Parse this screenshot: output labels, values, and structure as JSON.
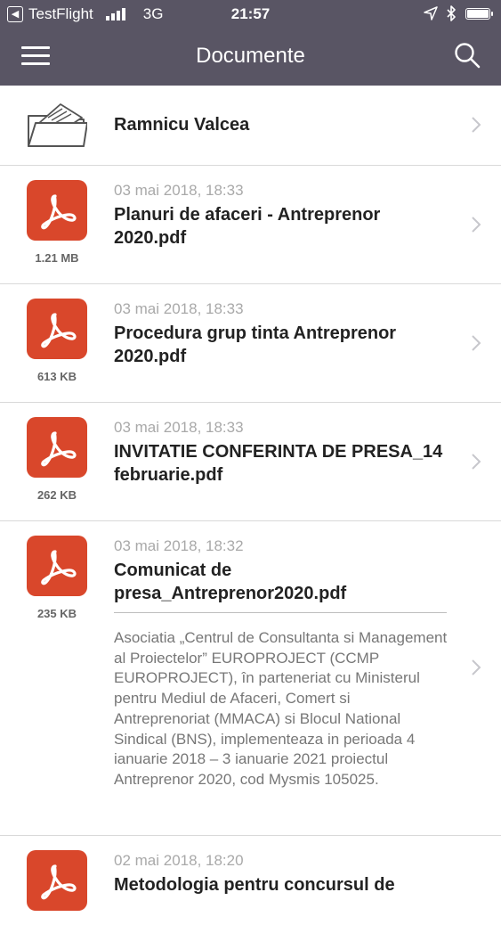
{
  "status_bar": {
    "back_app": "TestFlight",
    "network": "3G",
    "time": "21:57"
  },
  "nav": {
    "title": "Documente"
  },
  "folder": {
    "name": "Ramnicu Valcea"
  },
  "files": [
    {
      "date": "03 mai 2018, 18:33",
      "name": "Planuri de afaceri - Antreprenor 2020.pdf",
      "size": "1.21 MB"
    },
    {
      "date": "03 mai 2018, 18:33",
      "name": "Procedura grup tinta Antreprenor 2020.pdf",
      "size": "613 KB"
    },
    {
      "date": "03 mai 2018, 18:33",
      "name": "INVITATIE CONFERINTA DE PRESA_14 februarie.pdf",
      "size": "262 KB"
    },
    {
      "date": "03 mai 2018, 18:32",
      "name": "Comunicat de presa_Antreprenor2020.pdf",
      "size": "235 KB",
      "description": "Asociatia „Centrul de Consultanta si Management al Proiectelor” EUROPROJECT (CCMP EUROPROJECT), în parteneriat cu Ministerul pentru Mediul de Afaceri, Comert si Antreprenoriat (MMACA) si Blocul National Sindical (BNS), implementeaza in perioada 4 ianuarie 2018 – 3 ianuarie 2021 proiectul Antreprenor 2020, cod Mysmis 105025."
    },
    {
      "date": "02 mai 2018, 18:20",
      "name": "Metodologia pentru concursul de"
    }
  ],
  "colors": {
    "header": "#595564",
    "pdf_icon": "#d9472b",
    "date_text": "#a9a9a9"
  },
  "icons": [
    "back-arrow-icon",
    "signal-bars-icon",
    "location-arrow-icon",
    "bluetooth-icon",
    "battery-icon",
    "menu-icon",
    "search-icon",
    "folder-icon",
    "pdf-icon",
    "chevron-right-icon"
  ]
}
